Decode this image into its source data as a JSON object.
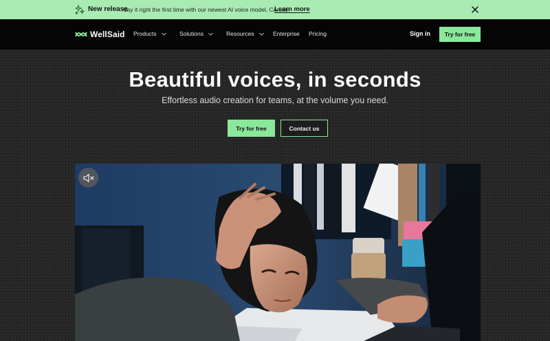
{
  "announcement": {
    "tag": "New release",
    "message": "Say it right the first time with our newest AI voice model, Caruso!",
    "link": "Learn more"
  },
  "nav": {
    "brand": "WellSaid",
    "items": [
      {
        "label": "Products",
        "dropdown": true
      },
      {
        "label": "Solutions",
        "dropdown": true
      },
      {
        "label": "Resources",
        "dropdown": true
      },
      {
        "label": "Enterprise",
        "dropdown": false
      },
      {
        "label": "Pricing",
        "dropdown": false
      }
    ],
    "sign_in": "Sign in",
    "cta": "Try for free"
  },
  "hero": {
    "title": "Beautiful voices, in seconds",
    "subtitle": "Effortless audio creation for teams, at the volume you need.",
    "primary_cta": "Try for free",
    "secondary_cta": "Contact us"
  },
  "colors": {
    "accent": "#8be89a",
    "announcement_bg": "#a8ecb4",
    "nav_bg": "#050505",
    "page_bg": "#262626"
  },
  "icons": {
    "sparkle": "sparkle-icon",
    "close": "close-icon",
    "chevron": "chevron-down-icon",
    "mute": "speaker-muted-icon"
  }
}
